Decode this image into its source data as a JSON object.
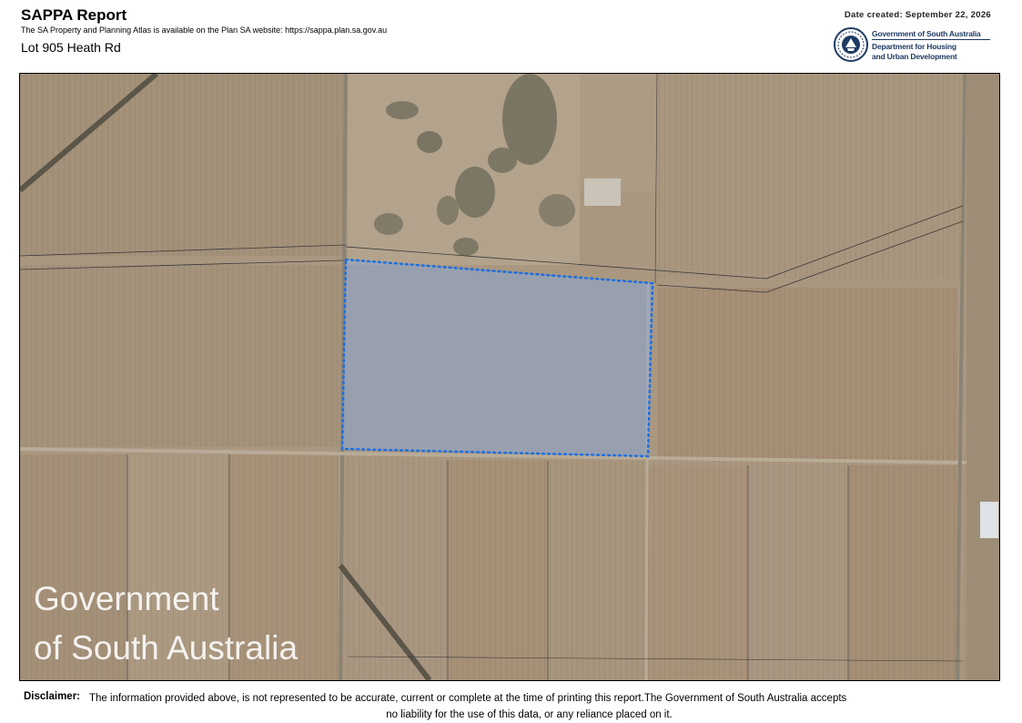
{
  "header": {
    "title": "SAPPA Report",
    "subtitle": "The SA Property and Planning Atlas is available on the Plan SA website: https://sappa.plan.sa.gov.au",
    "lot": "Lot 905 Heath Rd",
    "date": "Date created: September 22, 2026"
  },
  "logo": {
    "gov": "Government of South Australia",
    "dept_line1": "Department for Housing",
    "dept_line2": "and Urban Development",
    "icon": "state-seal-icon"
  },
  "map": {
    "watermark_line1": "Government",
    "watermark_line2": "of South Australia",
    "parcel_outline_color": "#1e6fe0",
    "parcel_fill_color": "#8aa7d6"
  },
  "footer": {
    "disclaimer_label": "Disclaimer:",
    "disclaimer_line1": "The information provided above, is not represented to be accurate, current or complete at the time of printing this report.The Government of South Australia accepts",
    "disclaimer_line2": "no liability for the use of this data, or any reliance placed on it."
  }
}
